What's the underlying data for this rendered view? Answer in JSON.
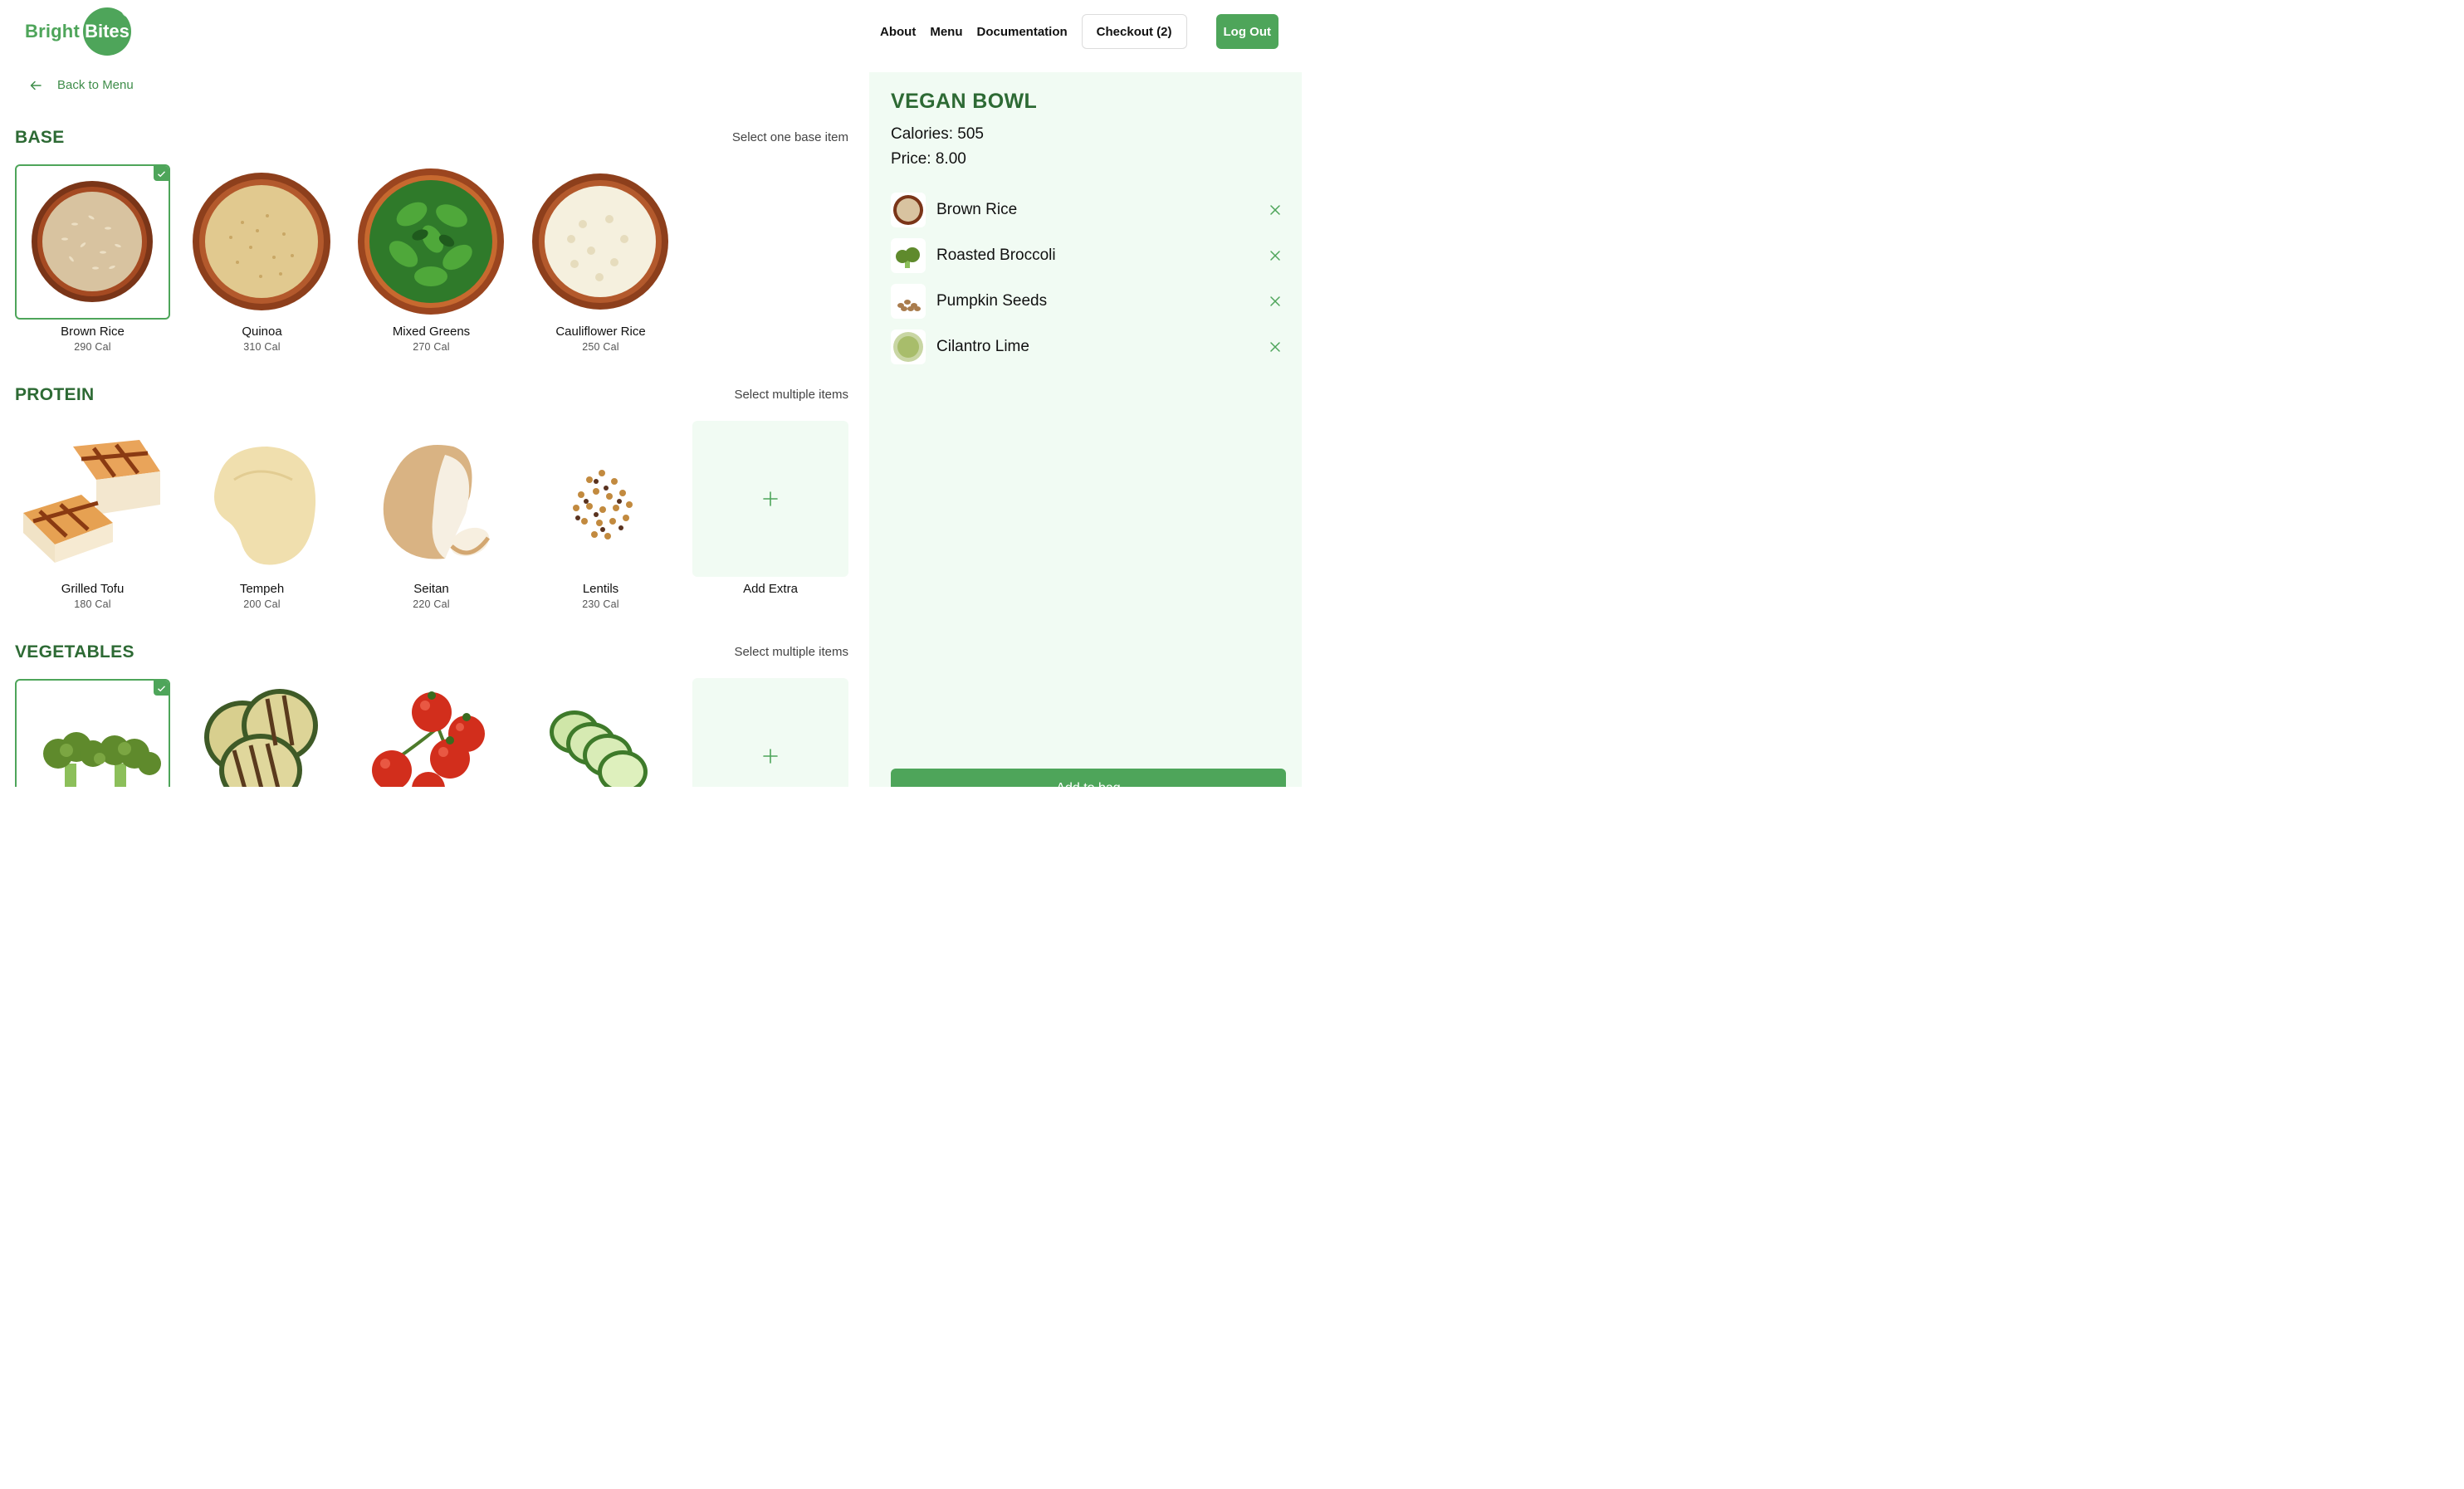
{
  "brand": {
    "word1": "Bright",
    "word2": "Bites",
    "color": "#4ea55a"
  },
  "nav": {
    "links": [
      "About",
      "Menu",
      "Documentation"
    ],
    "checkout": "Checkout (2)",
    "logout": "Log Out"
  },
  "back_label": "Back to Menu",
  "sections": {
    "base": {
      "title": "BASE",
      "hint": "Select one base item",
      "items": [
        {
          "name": "Brown Rice",
          "cal": "290 Cal",
          "selected": true,
          "icon": "brown-rice-bowl"
        },
        {
          "name": "Quinoa",
          "cal": "310 Cal",
          "selected": false,
          "icon": "quinoa-bowl"
        },
        {
          "name": "Mixed Greens",
          "cal": "270 Cal",
          "selected": false,
          "icon": "greens-bowl"
        },
        {
          "name": "Cauliflower Rice",
          "cal": "250 Cal",
          "selected": false,
          "icon": "cauliflower-bowl"
        }
      ]
    },
    "protein": {
      "title": "PROTEIN",
      "hint": "Select multiple items",
      "items": [
        {
          "name": "Grilled Tofu",
          "cal": "180 Cal",
          "selected": false,
          "icon": "tofu"
        },
        {
          "name": "Tempeh",
          "cal": "200 Cal",
          "selected": false,
          "icon": "tempeh"
        },
        {
          "name": "Seitan",
          "cal": "220 Cal",
          "selected": false,
          "icon": "seitan"
        },
        {
          "name": "Lentils",
          "cal": "230 Cal",
          "selected": false,
          "icon": "lentils"
        }
      ],
      "add_label": "Add Extra"
    },
    "vegetables": {
      "title": "VEGETABLES",
      "hint": "Select multiple items",
      "items": [
        {
          "name": "Roasted Broccoli",
          "selected": true,
          "icon": "broccoli"
        },
        {
          "name": "Grilled Zucchini",
          "selected": false,
          "icon": "zucchini"
        },
        {
          "name": "Cherry Tomatoes",
          "selected": false,
          "icon": "tomatoes"
        },
        {
          "name": "Cucumber",
          "selected": false,
          "icon": "cucumber"
        }
      ]
    }
  },
  "bowl": {
    "title": "VEGAN BOWL",
    "calories": "Calories: 505",
    "price": "Price: 8.00",
    "items": [
      {
        "name": "Brown Rice",
        "icon": "brown-rice-bowl"
      },
      {
        "name": "Roasted Broccoli",
        "icon": "broccoli"
      },
      {
        "name": "Pumpkin Seeds",
        "icon": "seeds"
      },
      {
        "name": "Cilantro Lime",
        "icon": "cilantro-lime"
      }
    ],
    "add_to_bag": "Add to bag"
  }
}
